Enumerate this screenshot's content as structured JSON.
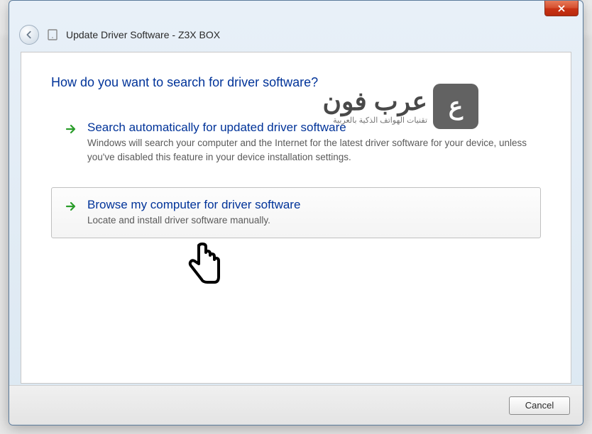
{
  "window": {
    "title": "Update Driver Software - Z3X BOX"
  },
  "heading": "How do you want to search for driver software?",
  "options": [
    {
      "title": "Search automatically for updated driver software",
      "description": "Windows will search your computer and the Internet for the latest driver software for your device, unless you've disabled this feature in your device installation settings."
    },
    {
      "title": "Browse my computer for driver software",
      "description": "Locate and install driver software manually."
    }
  ],
  "buttons": {
    "cancel": "Cancel"
  },
  "watermark": {
    "arabic": "عرب فون",
    "subtitle": "تقنيات الهواتف الذكية بالعربية"
  }
}
